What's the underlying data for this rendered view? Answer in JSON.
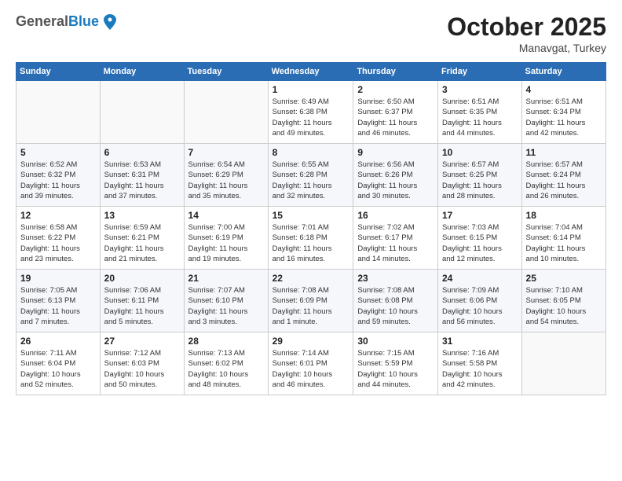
{
  "logo": {
    "general": "General",
    "blue": "Blue"
  },
  "header": {
    "month": "October 2025",
    "location": "Manavgat, Turkey"
  },
  "weekdays": [
    "Sunday",
    "Monday",
    "Tuesday",
    "Wednesday",
    "Thursday",
    "Friday",
    "Saturday"
  ],
  "weeks": [
    [
      {
        "day": "",
        "info": ""
      },
      {
        "day": "",
        "info": ""
      },
      {
        "day": "",
        "info": ""
      },
      {
        "day": "1",
        "info": "Sunrise: 6:49 AM\nSunset: 6:38 PM\nDaylight: 11 hours\nand 49 minutes."
      },
      {
        "day": "2",
        "info": "Sunrise: 6:50 AM\nSunset: 6:37 PM\nDaylight: 11 hours\nand 46 minutes."
      },
      {
        "day": "3",
        "info": "Sunrise: 6:51 AM\nSunset: 6:35 PM\nDaylight: 11 hours\nand 44 minutes."
      },
      {
        "day": "4",
        "info": "Sunrise: 6:51 AM\nSunset: 6:34 PM\nDaylight: 11 hours\nand 42 minutes."
      }
    ],
    [
      {
        "day": "5",
        "info": "Sunrise: 6:52 AM\nSunset: 6:32 PM\nDaylight: 11 hours\nand 39 minutes."
      },
      {
        "day": "6",
        "info": "Sunrise: 6:53 AM\nSunset: 6:31 PM\nDaylight: 11 hours\nand 37 minutes."
      },
      {
        "day": "7",
        "info": "Sunrise: 6:54 AM\nSunset: 6:29 PM\nDaylight: 11 hours\nand 35 minutes."
      },
      {
        "day": "8",
        "info": "Sunrise: 6:55 AM\nSunset: 6:28 PM\nDaylight: 11 hours\nand 32 minutes."
      },
      {
        "day": "9",
        "info": "Sunrise: 6:56 AM\nSunset: 6:26 PM\nDaylight: 11 hours\nand 30 minutes."
      },
      {
        "day": "10",
        "info": "Sunrise: 6:57 AM\nSunset: 6:25 PM\nDaylight: 11 hours\nand 28 minutes."
      },
      {
        "day": "11",
        "info": "Sunrise: 6:57 AM\nSunset: 6:24 PM\nDaylight: 11 hours\nand 26 minutes."
      }
    ],
    [
      {
        "day": "12",
        "info": "Sunrise: 6:58 AM\nSunset: 6:22 PM\nDaylight: 11 hours\nand 23 minutes."
      },
      {
        "day": "13",
        "info": "Sunrise: 6:59 AM\nSunset: 6:21 PM\nDaylight: 11 hours\nand 21 minutes."
      },
      {
        "day": "14",
        "info": "Sunrise: 7:00 AM\nSunset: 6:19 PM\nDaylight: 11 hours\nand 19 minutes."
      },
      {
        "day": "15",
        "info": "Sunrise: 7:01 AM\nSunset: 6:18 PM\nDaylight: 11 hours\nand 16 minutes."
      },
      {
        "day": "16",
        "info": "Sunrise: 7:02 AM\nSunset: 6:17 PM\nDaylight: 11 hours\nand 14 minutes."
      },
      {
        "day": "17",
        "info": "Sunrise: 7:03 AM\nSunset: 6:15 PM\nDaylight: 11 hours\nand 12 minutes."
      },
      {
        "day": "18",
        "info": "Sunrise: 7:04 AM\nSunset: 6:14 PM\nDaylight: 11 hours\nand 10 minutes."
      }
    ],
    [
      {
        "day": "19",
        "info": "Sunrise: 7:05 AM\nSunset: 6:13 PM\nDaylight: 11 hours\nand 7 minutes."
      },
      {
        "day": "20",
        "info": "Sunrise: 7:06 AM\nSunset: 6:11 PM\nDaylight: 11 hours\nand 5 minutes."
      },
      {
        "day": "21",
        "info": "Sunrise: 7:07 AM\nSunset: 6:10 PM\nDaylight: 11 hours\nand 3 minutes."
      },
      {
        "day": "22",
        "info": "Sunrise: 7:08 AM\nSunset: 6:09 PM\nDaylight: 11 hours\nand 1 minute."
      },
      {
        "day": "23",
        "info": "Sunrise: 7:08 AM\nSunset: 6:08 PM\nDaylight: 10 hours\nand 59 minutes."
      },
      {
        "day": "24",
        "info": "Sunrise: 7:09 AM\nSunset: 6:06 PM\nDaylight: 10 hours\nand 56 minutes."
      },
      {
        "day": "25",
        "info": "Sunrise: 7:10 AM\nSunset: 6:05 PM\nDaylight: 10 hours\nand 54 minutes."
      }
    ],
    [
      {
        "day": "26",
        "info": "Sunrise: 7:11 AM\nSunset: 6:04 PM\nDaylight: 10 hours\nand 52 minutes."
      },
      {
        "day": "27",
        "info": "Sunrise: 7:12 AM\nSunset: 6:03 PM\nDaylight: 10 hours\nand 50 minutes."
      },
      {
        "day": "28",
        "info": "Sunrise: 7:13 AM\nSunset: 6:02 PM\nDaylight: 10 hours\nand 48 minutes."
      },
      {
        "day": "29",
        "info": "Sunrise: 7:14 AM\nSunset: 6:01 PM\nDaylight: 10 hours\nand 46 minutes."
      },
      {
        "day": "30",
        "info": "Sunrise: 7:15 AM\nSunset: 5:59 PM\nDaylight: 10 hours\nand 44 minutes."
      },
      {
        "day": "31",
        "info": "Sunrise: 7:16 AM\nSunset: 5:58 PM\nDaylight: 10 hours\nand 42 minutes."
      },
      {
        "day": "",
        "info": ""
      }
    ]
  ]
}
